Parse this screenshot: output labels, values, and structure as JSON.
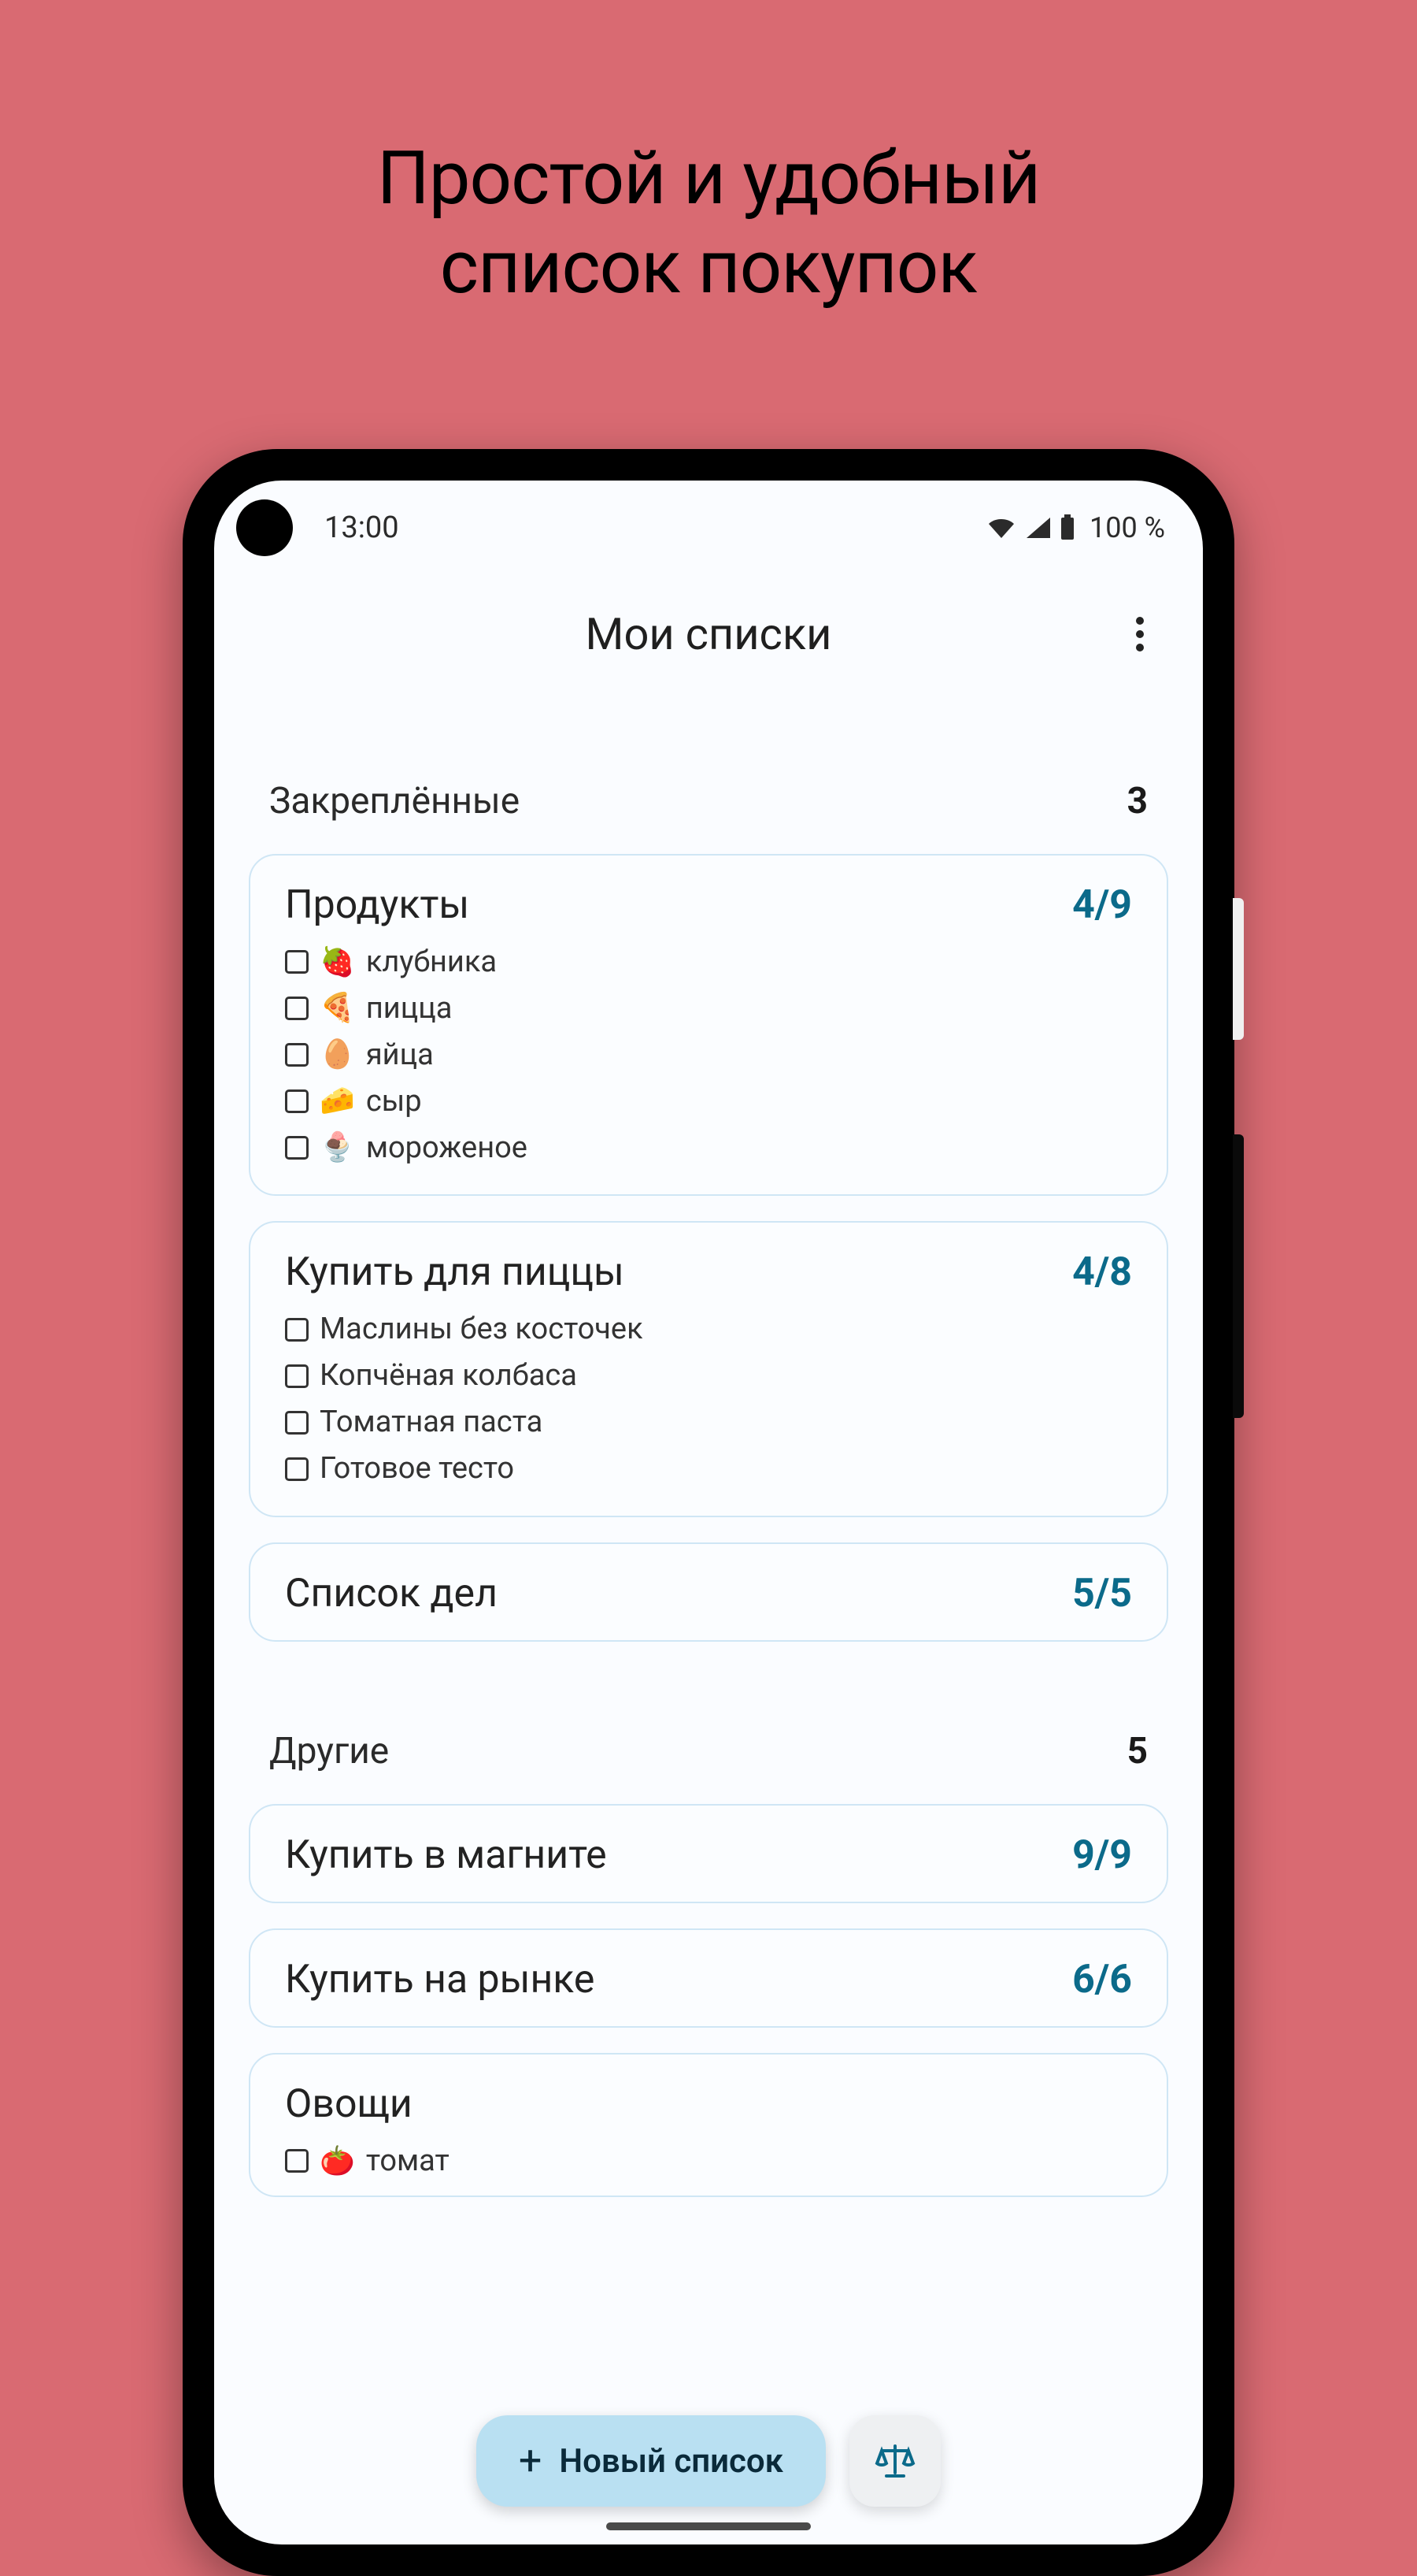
{
  "headline_line1": "Простой и удобный",
  "headline_line2": "список покупок",
  "status": {
    "time": "13:00",
    "battery_text": "100 %"
  },
  "app_title": "Мои списки",
  "sections": {
    "pinned": {
      "title": "Закреплённые",
      "count": "3"
    },
    "other": {
      "title": "Другие",
      "count": "5"
    }
  },
  "cards": {
    "products": {
      "title": "Продукты",
      "counter": "4/9",
      "items": [
        {
          "emoji": "🍓",
          "label": "клубника"
        },
        {
          "emoji": "🍕",
          "label": "пицца"
        },
        {
          "emoji": "🥚",
          "label": "яйца"
        },
        {
          "emoji": "🧀",
          "label": "сыр"
        },
        {
          "emoji": "🍨",
          "label": "мороженое"
        }
      ]
    },
    "pizza": {
      "title": "Купить для пиццы",
      "counter": "4/8",
      "items": [
        {
          "label": "Маслины без косточек"
        },
        {
          "label": "Копчёная колбаса"
        },
        {
          "label": "Томатная паста"
        },
        {
          "label": "Готовое тесто"
        }
      ]
    },
    "todo": {
      "title": "Список дел",
      "counter": "5/5"
    },
    "magnit": {
      "title": "Купить в магните",
      "counter": "9/9"
    },
    "market": {
      "title": "Купить на рынке",
      "counter": "6/6"
    },
    "veg": {
      "title": "Овощи",
      "items": [
        {
          "emoji": "🍅",
          "label": "томат"
        }
      ]
    }
  },
  "fab": {
    "new_list": "Новый список"
  }
}
